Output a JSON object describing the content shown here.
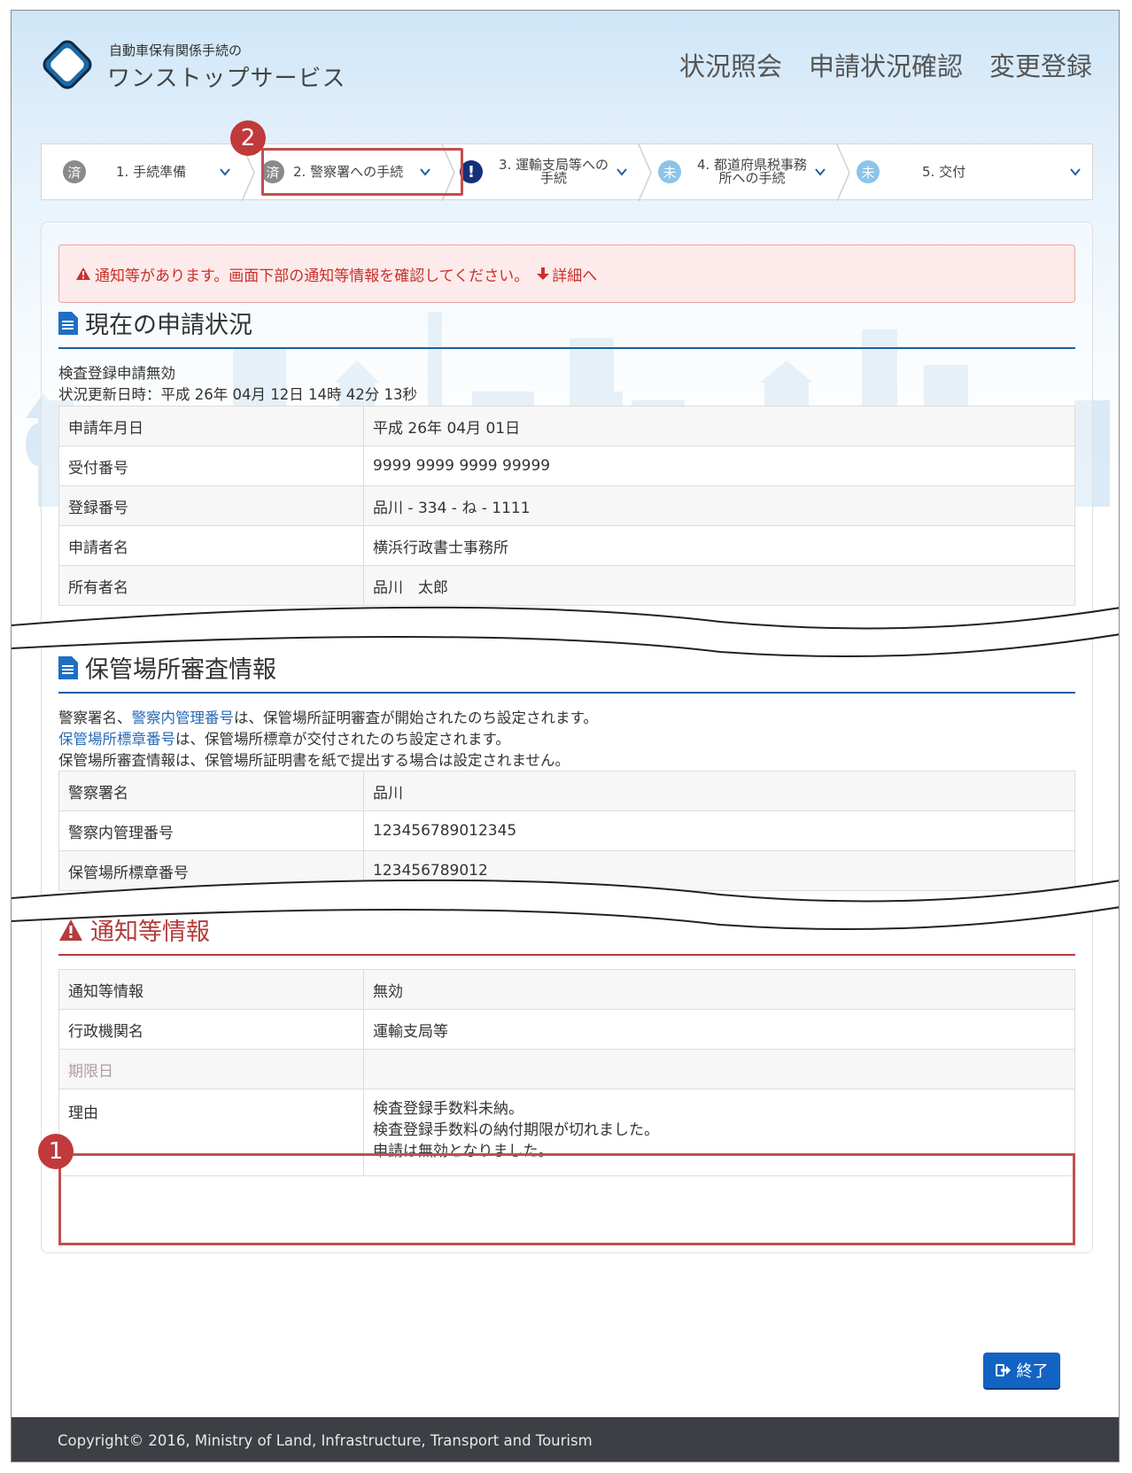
{
  "header": {
    "logo_sub": "自動車保有関係手続の",
    "logo_main": "ワンストップサービス",
    "nav": [
      "状況照会",
      "申請状況確認",
      "変更登録"
    ]
  },
  "steps": [
    {
      "badge": "済",
      "label": "1. 手続準備",
      "state": "done"
    },
    {
      "badge": "済",
      "label": "2. 警察署への手続",
      "state": "done"
    },
    {
      "badge": "!",
      "label": "3. 運輸支局等への 手続",
      "state": "warning"
    },
    {
      "badge": "未",
      "label": "4. 都道府県税事務 所への手続",
      "state": "todo"
    },
    {
      "badge": "未",
      "label": "5. 交付",
      "state": "todo"
    }
  ],
  "callouts": {
    "one": "1",
    "two": "2"
  },
  "alert": {
    "text": "通知等があります。画面下部の通知等情報を確認してください。",
    "link": "詳細へ"
  },
  "status_section": {
    "title": "現在の申請状況",
    "status": "検査登録申請無効",
    "updated": "状況更新日時：平成 26年 04月 12日 14時 42分 13秒",
    "rows": [
      {
        "k": "申請年月日",
        "v": "平成 26年 04月 01日"
      },
      {
        "k": "受付番号",
        "v": "9999 9999 9999 99999"
      },
      {
        "k": "登録番号",
        "v": "品川 - 334 - ね - 1111"
      },
      {
        "k": "申請者名",
        "v": "横浜行政書士事務所"
      },
      {
        "k": "所有者名",
        "v": "品川　太郎"
      }
    ]
  },
  "storage_section": {
    "title": "保管場所審査情報",
    "note1_a": "警察署名、",
    "note1_b": "警察内管理番号",
    "note1_c": "は、保管場所証明審査が開始されたのち設定されます。",
    "note2_a": "保管場所標章番号",
    "note2_b": "は、保管場所標章が交付されたのち設定されます。",
    "note3": "保管場所審査情報は、保管場所証明書を紙で提出する場合は設定されません。",
    "rows": [
      {
        "k": "警察署名",
        "v": "品川"
      },
      {
        "k": "警察内管理番号",
        "v": "123456789012345"
      },
      {
        "k": "保管場所標章番号",
        "v": "123456789012"
      }
    ]
  },
  "notice_section": {
    "title": "通知等情報",
    "rows": [
      {
        "k": "通知等情報",
        "v": "無効"
      },
      {
        "k": "行政機関名",
        "v": "運輸支局等"
      },
      {
        "k": "期限日",
        "v": ""
      }
    ],
    "reason_label": "理由",
    "reason_lines": [
      "検査登録手数料未納。",
      "検査登録手数料の納付期限が切れました。",
      "申請は無効となりました。"
    ]
  },
  "exit_label": "終了",
  "footer": "Copyright© 2016, Ministry of Land, Infrastructure, Transport and Tourism",
  "colors": {
    "primary": "#1363c2",
    "accent_red": "#c0504d",
    "heading_blue": "#1d5f9e",
    "footer_bg": "#3c3f44"
  }
}
